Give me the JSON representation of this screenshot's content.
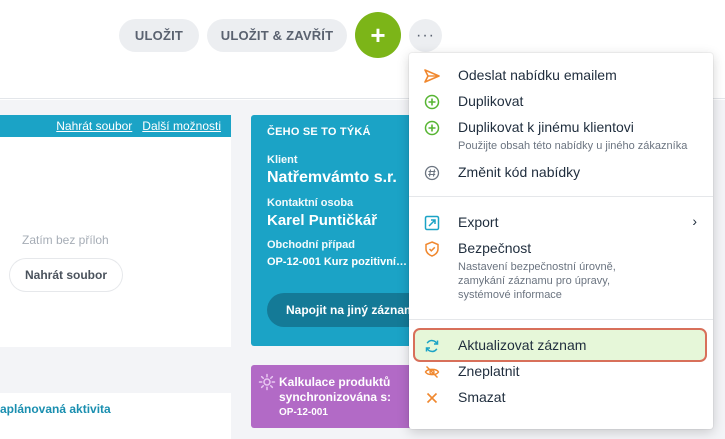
{
  "toolbar": {
    "save_label": "ULOŽIT",
    "save_close_label": "ULOŽIT & ZAVŘÍT",
    "add_label": "+",
    "more_label": "···"
  },
  "attachments": {
    "upload_link": "Nahrát soubor",
    "more_link": "Další možnosti",
    "empty_text": "Zatím bez příloh",
    "upload_button": "Nahrát soubor"
  },
  "activity": {
    "label": "aplánovaná aktivita"
  },
  "info_card": {
    "heading": "ČEHO SE TO TÝKÁ",
    "client_label": "Klient",
    "client_value": "Natřemvámto s.r.",
    "contact_label": "Kontaktní osoba",
    "contact_value": "Karel Puntičkář",
    "case_label": "Obchodní případ",
    "case_value": "OP-12-001 Kurz pozitivní…",
    "link_button": "Napojit na jiný záznam"
  },
  "calc_card": {
    "title": "Kalkulace produktů synchronizována s:",
    "ref": "OP-12-001"
  },
  "menu": {
    "send_email": "Odeslat nabídku emailem",
    "duplicate": "Duplikovat",
    "duplicate_other": "Duplikovat k jinému klientovi",
    "duplicate_other_sub": "Použijte obsah této nabídky u jiného zákazníka",
    "change_code": "Změnit kód nabídky",
    "export": "Export",
    "security": "Bezpečnost",
    "security_sub": "Nastavení bezpečnostní úrovně, zamykání záznamu pro úpravy, systémové informace",
    "refresh": "Aktualizovat záznam",
    "invalidate": "Zneplatnit",
    "delete": "Smazat",
    "export_chevron": "›"
  },
  "colors": {
    "accent_teal": "#1ba3c6",
    "add_green": "#7cb518",
    "calc_purple": "#b26ac6",
    "highlight_fill": "#e6f7d9",
    "highlight_border": "#d8705a",
    "icon_orange": "#f0882f",
    "icon_green": "#57b533",
    "icon_blue": "#1ba3c6",
    "icon_gray": "#6b7480"
  }
}
